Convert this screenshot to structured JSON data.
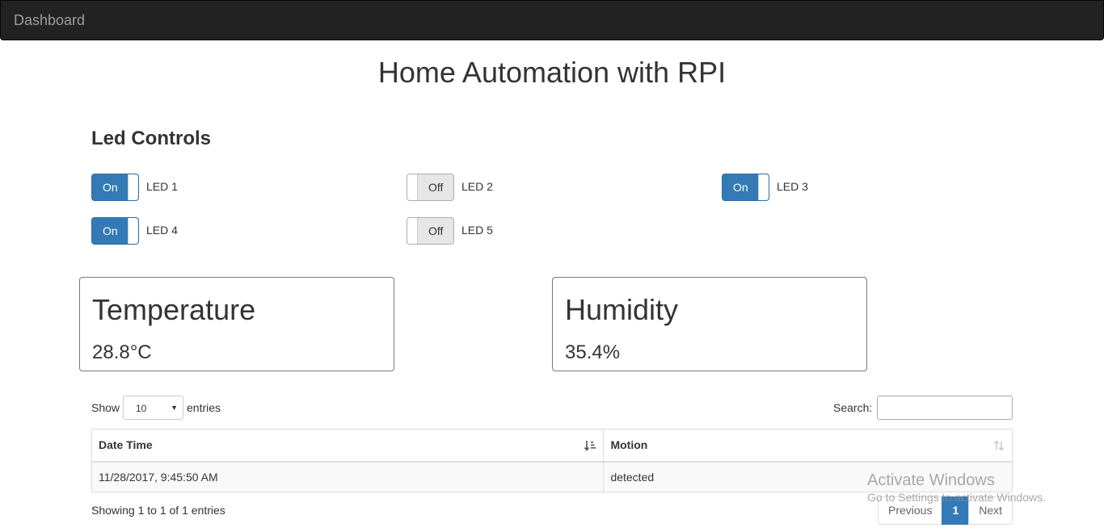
{
  "navbar": {
    "brand": "Dashboard"
  },
  "page_title": "Home Automation with RPI",
  "led_section": {
    "title": "Led Controls",
    "leds": [
      {
        "label": "LED 1",
        "state": "On"
      },
      {
        "label": "LED 2",
        "state": "Off"
      },
      {
        "label": "LED 3",
        "state": "On"
      },
      {
        "label": "LED 4",
        "state": "On"
      },
      {
        "label": "LED 5",
        "state": "Off"
      }
    ]
  },
  "sensors": {
    "temperature": {
      "title": "Temperature",
      "value": "28.8°C"
    },
    "humidity": {
      "title": "Humidity",
      "value": "35.4%"
    }
  },
  "table": {
    "length": {
      "prefix": "Show",
      "selected": "10",
      "suffix": "entries"
    },
    "search": {
      "label": "Search:",
      "value": ""
    },
    "columns": [
      "Date Time",
      "Motion"
    ],
    "rows": [
      [
        "11/28/2017, 9:45:50 AM",
        "detected"
      ]
    ],
    "info": "Showing 1 to 1 of 1 entries",
    "pagination": {
      "previous": "Previous",
      "current": "1",
      "next": "Next"
    }
  },
  "watermark": {
    "line1": "Activate Windows",
    "line2": "Go to Settings to activate Windows."
  },
  "colors": {
    "navbar_bg": "#222222",
    "primary": "#337ab7"
  }
}
